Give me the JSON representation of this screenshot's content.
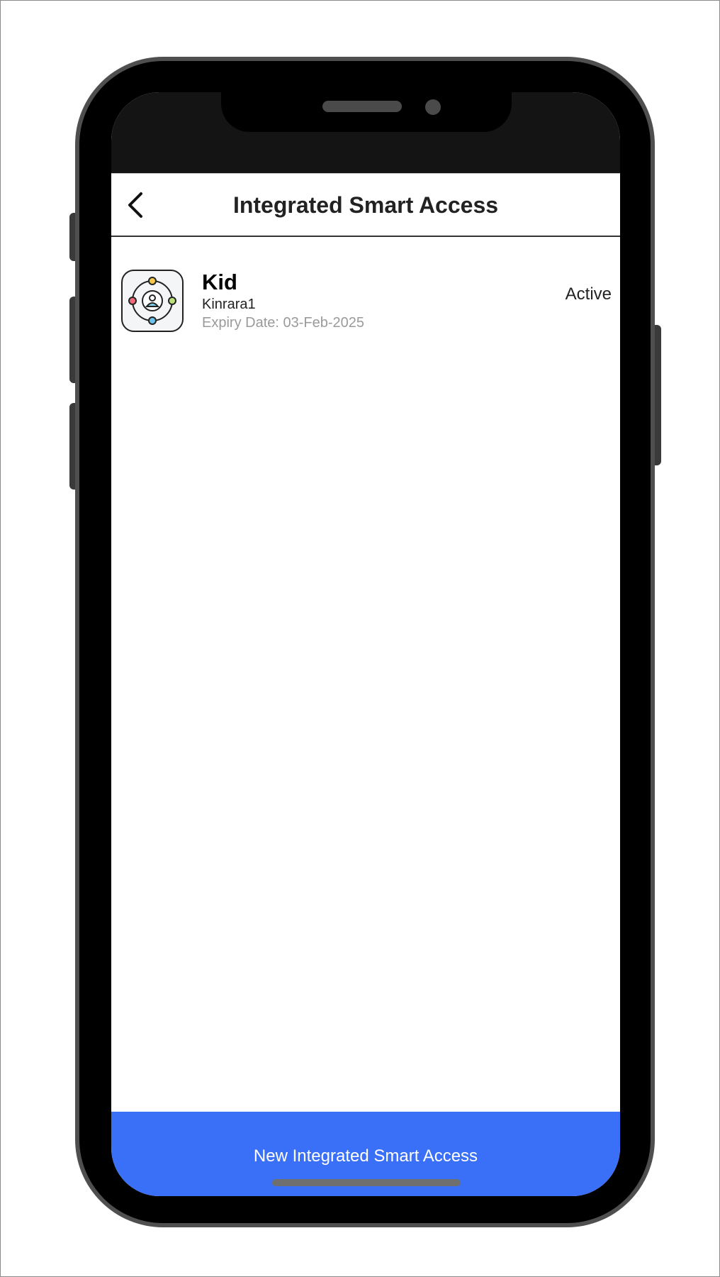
{
  "header": {
    "title": "Integrated Smart Access",
    "back_icon": "chevron-left-icon"
  },
  "access_list": [
    {
      "title": "Kid",
      "subtitle": "Kinrara1",
      "expiry": "Expiry Date: 03-Feb-2025",
      "status": "Active",
      "icon": "family-orbit-icon"
    }
  ],
  "footer": {
    "button_label": "New Integrated Smart Access"
  },
  "colors": {
    "accent": "#3a6ff7",
    "status_bar": "#141414",
    "phone_frame": "#4f4f4f",
    "expiry_text": "#9a9a9a"
  }
}
